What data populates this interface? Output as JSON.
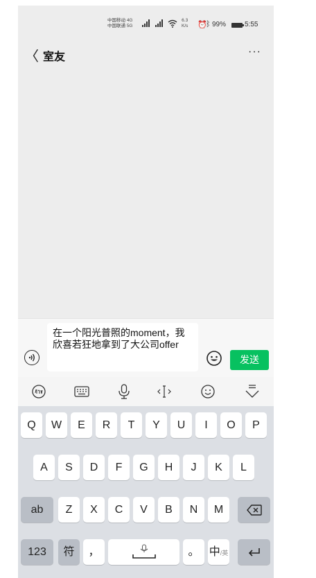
{
  "status_bar": {
    "carrier_1": "中国移动",
    "carrier_2": "中国联通",
    "network_1": "4G",
    "network_2": "5G",
    "speed_value": "6.3",
    "speed_unit": "K/s",
    "battery": "99%",
    "time": "5:55"
  },
  "nav": {
    "back_symbol": "〈",
    "title": "室友",
    "more_symbol": "···"
  },
  "input": {
    "message": "在一个阳光普照的moment，我欣喜若狂地拿到了大公司offer",
    "send_label": "发送"
  },
  "keyboard": {
    "row1": [
      "Q",
      "W",
      "E",
      "R",
      "T",
      "Y",
      "U",
      "I",
      "O",
      "P"
    ],
    "row2": [
      "A",
      "S",
      "D",
      "F",
      "G",
      "H",
      "J",
      "K",
      "L"
    ],
    "row3": [
      "Z",
      "X",
      "C",
      "V",
      "B",
      "N",
      "M"
    ],
    "shift_label": "ab",
    "numbers_label": "123",
    "symbols_label": "符",
    "comma": "，",
    "period": "。",
    "lang_main": "中",
    "lang_sub": "/英"
  },
  "toolbar_icons": [
    "handwriting-icon",
    "keyboard-icon",
    "microphone-icon",
    "cursor-icon",
    "emoji-icon",
    "collapse-keyboard-icon"
  ],
  "colors": {
    "send": "#07c160",
    "chat_bg": "#ededed",
    "keyboard_bg": "#dcdfe4"
  }
}
